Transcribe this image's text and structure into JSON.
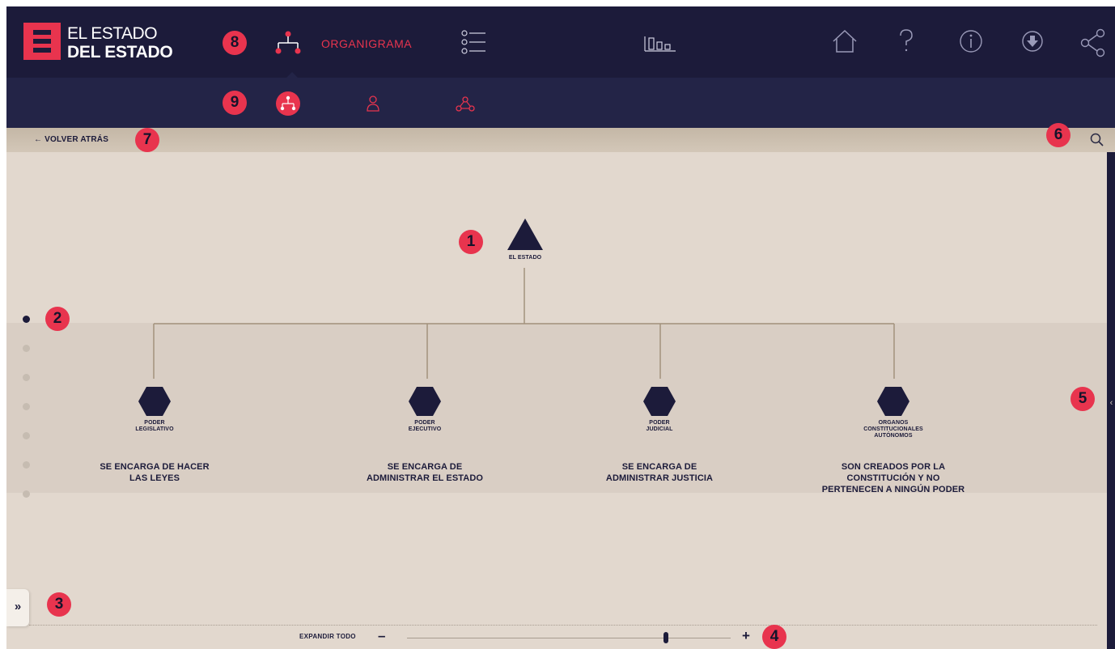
{
  "app": {
    "logo_line1": "EL ESTADO",
    "logo_line2": "DEL ESTADO"
  },
  "nav": {
    "active_label": "ORGANIGRAMA",
    "icons": [
      "org-chart-icon",
      "list-icon",
      "stats-chart-icon",
      "home-icon",
      "help-icon",
      "info-icon",
      "download-icon",
      "share-icon"
    ]
  },
  "subnav": {
    "icons": [
      "org-chart-icon",
      "person-icon",
      "network-icon"
    ],
    "active_index": 0
  },
  "back": {
    "label": "← VOLVER ATRÁS"
  },
  "tree": {
    "root": {
      "label": "EL ESTADO",
      "icon": "triangle"
    },
    "children": [
      {
        "label": "PODER\nLEGISLATIVO",
        "desc": "SE ENCARGA DE HACER\nLAS LEYES"
      },
      {
        "label": "PODER\nEJECUTIVO",
        "desc": "SE ENCARGA DE\nADMINISTRAR EL ESTADO"
      },
      {
        "label": "PODER\nJUDICIAL",
        "desc": "SE ENCARGA DE\nADMINISTRAR JUSTICIA"
      },
      {
        "label": "ORGANOS\nCONSTITUCIONALES\nAUTÓNOMOS",
        "desc": "SON CREADOS POR LA\nCONSTITUCIÓN Y NO\nPERTENECEN A NINGÚN PODER"
      }
    ]
  },
  "levels": {
    "count": 7,
    "active_index": 0
  },
  "controls": {
    "expand_label": "EXPANDIR TODO",
    "zoom_minus": "–",
    "zoom_plus": "+",
    "zoom_level": 0.8,
    "expand_panel_glyph": "»",
    "right_panel_glyph": "‹"
  },
  "callouts": [
    "1",
    "2",
    "3",
    "4",
    "5",
    "6",
    "7",
    "8",
    "9"
  ],
  "colors": {
    "navy": "#1c1b3a",
    "accent": "#e8344e",
    "background": "#e2d8ce",
    "band": "#d9cec4"
  }
}
